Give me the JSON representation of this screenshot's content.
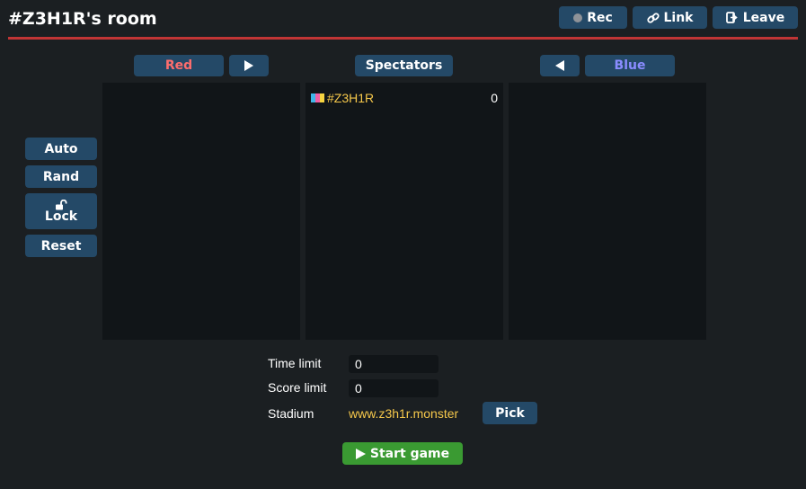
{
  "header": {
    "title": "#Z3H1R's room",
    "rec_label": "Rec",
    "link_label": "Link",
    "leave_label": "Leave"
  },
  "teams": {
    "red_label": "Red",
    "spectators_label": "Spectators",
    "blue_label": "Blue",
    "red_color": "#fd6d6d",
    "blue_color": "#8a8cff"
  },
  "spectators": [
    {
      "name": "#Z3H1R",
      "ping": "0"
    }
  ],
  "controls": {
    "auto_label": "Auto",
    "rand_label": "Rand",
    "lock_label": "Lock",
    "reset_label": "Reset"
  },
  "settings": {
    "time_limit_label": "Time limit",
    "time_limit_value": "0",
    "score_limit_label": "Score limit",
    "score_limit_value": "0",
    "stadium_label": "Stadium",
    "stadium_value": "www.z3h1r.monster",
    "pick_label": "Pick"
  },
  "start_label": "Start game",
  "colors": {
    "background": "#1b1f22",
    "button": "#244967",
    "header_rule": "#c13535",
    "start_button": "#3a9a32",
    "player_name": "#f6c84b"
  }
}
